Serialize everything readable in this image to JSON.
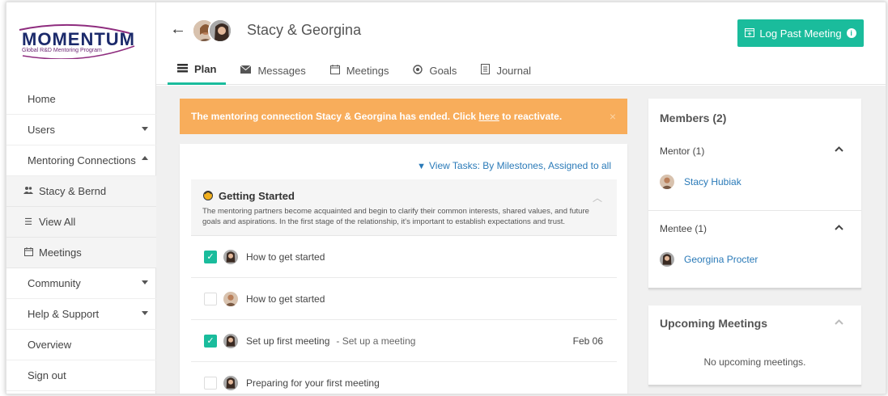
{
  "sidebar": {
    "logo_title": "MOMENTUM",
    "logo_subtitle": "Global R&D Mentoring Program",
    "items": [
      {
        "label": "Home"
      },
      {
        "label": "Users"
      },
      {
        "label": "Mentoring Connections"
      },
      {
        "label": "Stacy & Bernd",
        "icon": "users-icon"
      },
      {
        "label": "View All",
        "icon": "list-icon"
      },
      {
        "label": "Meetings",
        "icon": "calendar-icon"
      },
      {
        "label": "Community"
      },
      {
        "label": "Help & Support"
      },
      {
        "label": "Overview"
      },
      {
        "label": "Sign out"
      }
    ]
  },
  "header": {
    "title": "Stacy & Georgina",
    "log_button": "Log Past Meeting",
    "tabs": [
      {
        "label": "Plan",
        "icon": "plan-icon",
        "active": true
      },
      {
        "label": "Messages",
        "icon": "envelope-icon"
      },
      {
        "label": "Meetings",
        "icon": "calendar-icon"
      },
      {
        "label": "Goals",
        "icon": "target-icon"
      },
      {
        "label": "Journal",
        "icon": "journal-icon"
      }
    ]
  },
  "alert": {
    "text_before": "The mentoring connection Stacy & Georgina has ended. Click ",
    "link": "here",
    "text_after": " to reactivate.",
    "close": "×"
  },
  "plan": {
    "view_tasks": "View Tasks: By Milestones, Assigned to all",
    "milestone": {
      "title": "Getting Started",
      "description": "The mentoring partners become acquainted and begin to clarify their common interests, shared values, and future goals and aspirations. In the first stage of the relationship, it's important to establish expectations and trust."
    },
    "tasks": [
      {
        "title": "How to get started",
        "checked": true,
        "subtitle": "",
        "date": ""
      },
      {
        "title": "How to get started",
        "checked": false,
        "subtitle": "",
        "date": ""
      },
      {
        "title": "Set up first meeting",
        "checked": true,
        "subtitle": "- Set up a meeting",
        "date": "Feb 06"
      },
      {
        "title": "Preparing for your first meeting",
        "checked": false,
        "subtitle": "",
        "date": ""
      }
    ]
  },
  "members": {
    "title": "Members (2)",
    "mentor_label": "Mentor (1)",
    "mentor_name": "Stacy Hubiak",
    "mentee_label": "Mentee (1)",
    "mentee_name": "Georgina Procter"
  },
  "upcoming": {
    "title": "Upcoming Meetings",
    "empty": "No upcoming meetings."
  },
  "colors": {
    "accent": "#1abc9c",
    "alert": "#f8ad5b",
    "link": "#2a7ab8"
  }
}
